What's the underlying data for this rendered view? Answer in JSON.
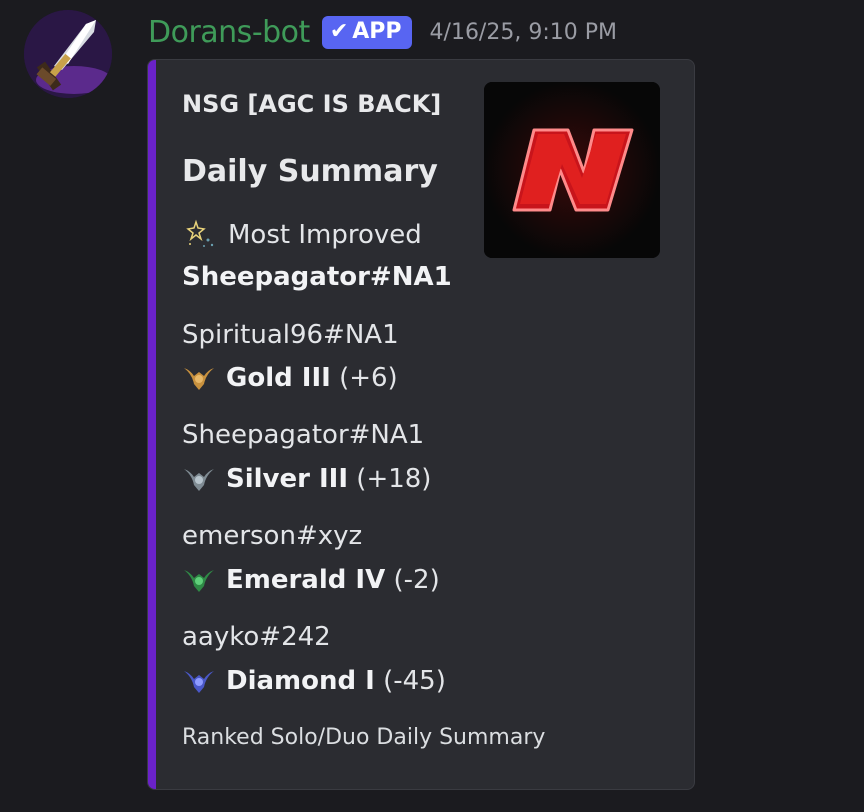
{
  "message": {
    "username": "Dorans-bot",
    "badge": "APP",
    "timestamp": "4/16/25, 9:10 PM"
  },
  "embed": {
    "author": "NSG [AGC IS BACK]",
    "title": "Daily Summary",
    "most_improved": {
      "label": "Most Improved",
      "player": "Sheepagator#NA1"
    },
    "entries": [
      {
        "player": "Spiritual96#NA1",
        "rank": "Gold III",
        "delta": "(+6)",
        "icon": "gold-rank-icon",
        "color": "#c8913e"
      },
      {
        "player": "Sheepagator#NA1",
        "rank": "Silver III",
        "delta": "(+18)",
        "icon": "silver-rank-icon",
        "color": "#8c9aa3"
      },
      {
        "player": "emerson#xyz",
        "rank": "Emerald IV",
        "delta": "(-2)",
        "icon": "emerald-rank-icon",
        "color": "#3a9c54"
      },
      {
        "player": "aayko#242",
        "rank": "Diamond I",
        "delta": "(-45)",
        "icon": "diamond-rank-icon",
        "color": "#5b6ad8"
      }
    ],
    "footer": "Ranked Solo/Duo Daily Summary",
    "accent_color": "#6a22c9"
  }
}
